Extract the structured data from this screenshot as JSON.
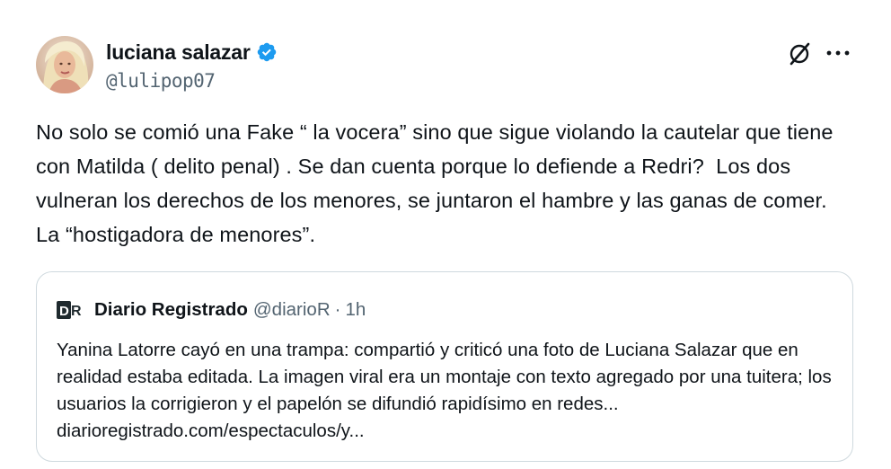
{
  "author": {
    "display_name": "luciana salazar",
    "handle": "@lulipop07",
    "verified": true,
    "verified_color": "#1d9bf0",
    "avatar_icon": "profile-photo"
  },
  "actions": {
    "grok_icon": "grok-icon",
    "more_icon": "more-options-icon"
  },
  "tweet": {
    "text": "No solo se comió una Fake “ la vocera” sino que sigue violando la cautelar que tiene con Matilda ( delito penal) . Se dan cuenta porque lo defiende a Redri?  Los dos vulneran los derechos de los menores, se juntaron el hambre y las ganas de comer. La “hostigadora de menores”."
  },
  "quoted_tweet": {
    "logo_text": "DR",
    "display_name": "Diario Registrado",
    "handle": "@diarioR",
    "separator": "·",
    "time": "1h",
    "text": "Yanina Latorre cayó en una trampa: compartió y criticó una foto de Luciana Salazar que en realidad estaba editada. La imagen viral era un montaje con texto agregado por una tuitera; los usuarios la corrigieron y el papelón se difundió rapidísimo en redes... diarioregistrado.com/espectaculos/y..."
  },
  "colors": {
    "text_primary": "#0f1419",
    "text_secondary": "#536471",
    "border": "#cfd9de"
  }
}
